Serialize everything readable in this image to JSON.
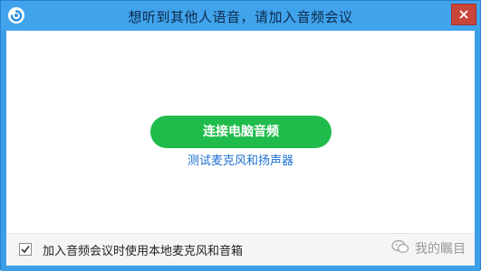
{
  "window": {
    "title": "想听到其他人语音，请加入音频会议"
  },
  "main": {
    "connect_button_label": "连接电脑音频",
    "test_link_label": "测试麦克风和扬声器"
  },
  "footer": {
    "checkbox_label": "加入音频会议时使用本地麦克风和音箱",
    "checkbox_checked": true,
    "watermark_text": "我的瞩目"
  },
  "icons": {
    "app_logo": "app-logo-icon",
    "close": "close-icon",
    "check": "checkmark-icon",
    "wechat": "wechat-icon"
  },
  "colors": {
    "titlebar": "#41a3ec",
    "accent_green": "#1fbc4b",
    "link_blue": "#1c6fd1",
    "close_red": "#c8453a"
  }
}
